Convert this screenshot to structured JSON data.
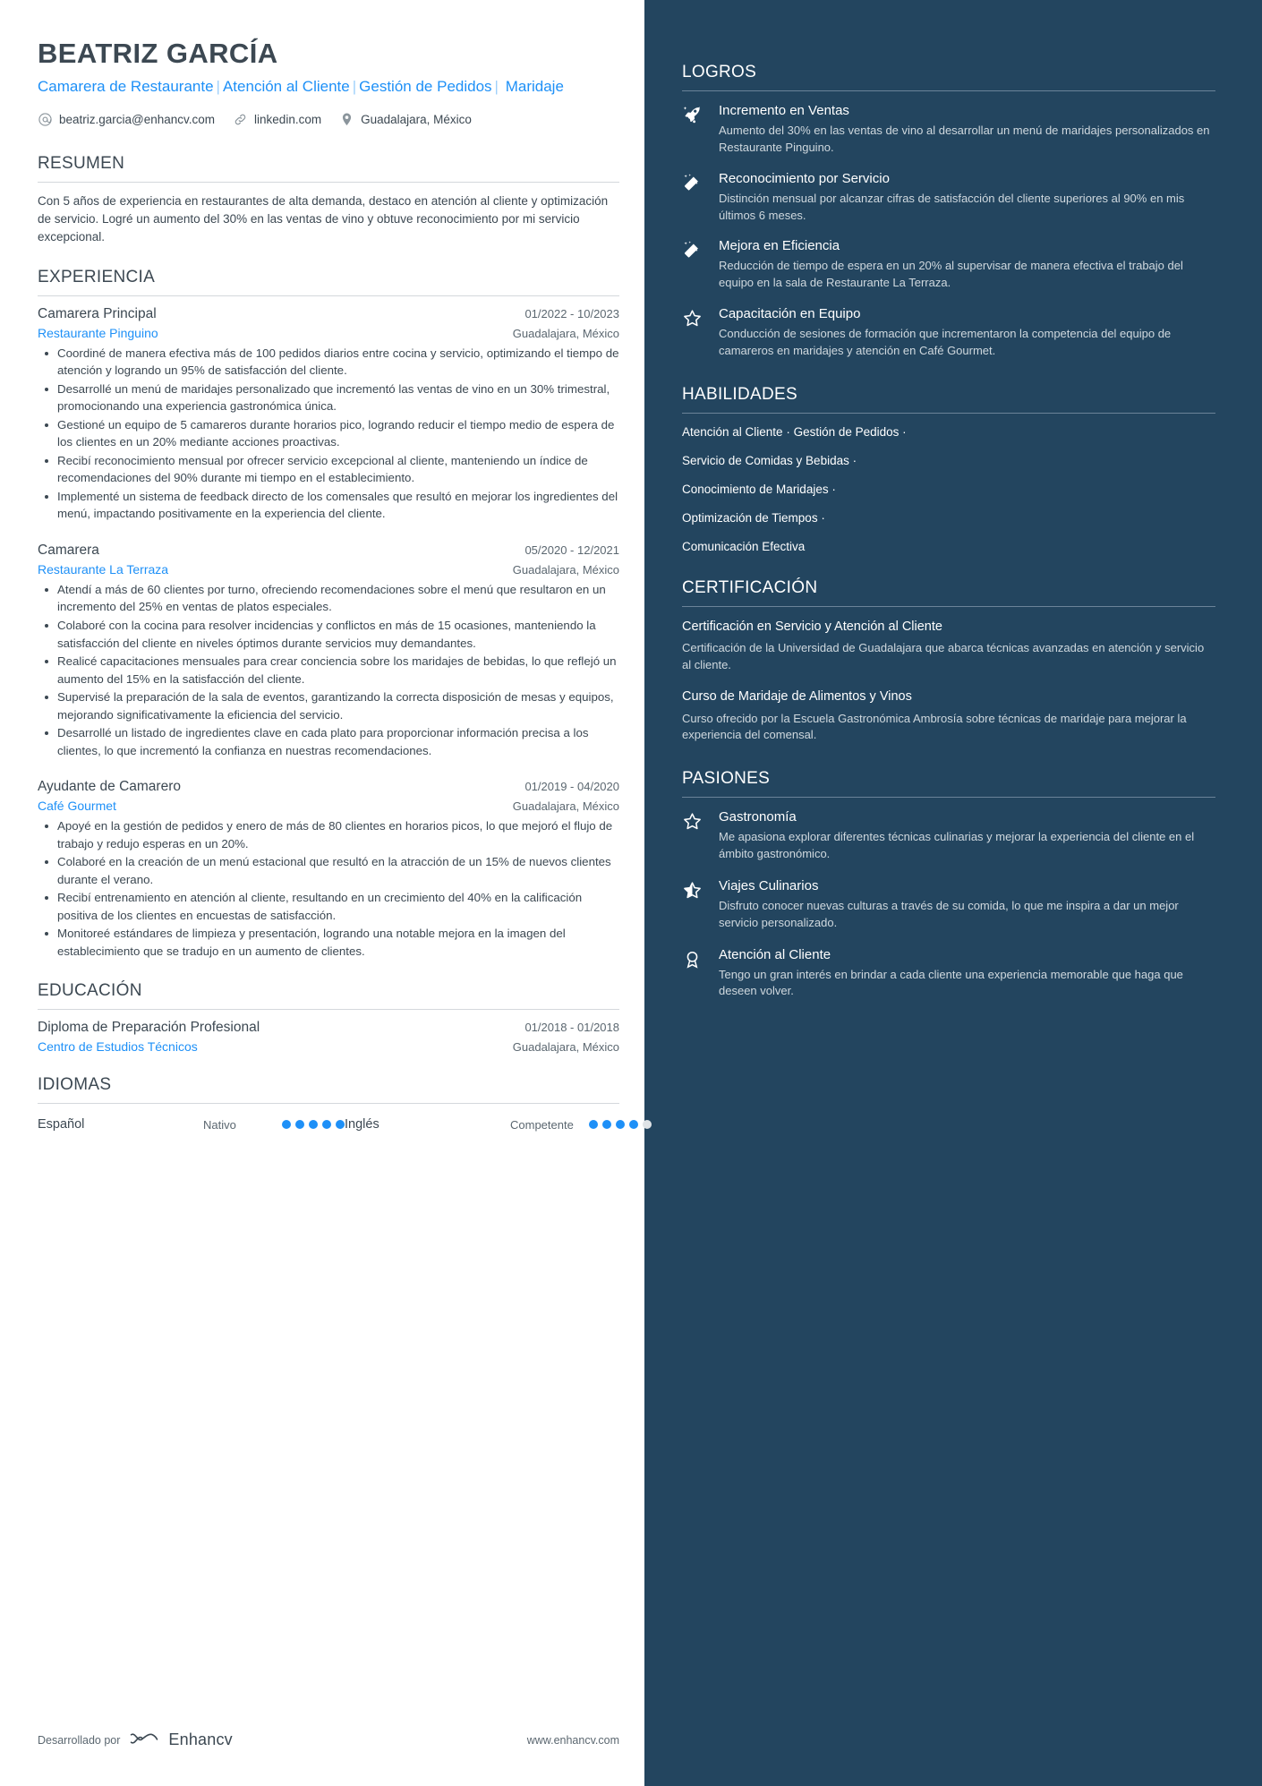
{
  "header": {
    "name": "BEATRIZ GARCÍA",
    "headline_parts": [
      "Camarera de Restaurante",
      "Atención al Cliente",
      "Gestión de Pedidos",
      "Maridaje"
    ],
    "contacts": [
      {
        "icon": "at-icon",
        "text": "beatriz.garcia@enhancv.com"
      },
      {
        "icon": "link-icon",
        "text": "linkedin.com"
      },
      {
        "icon": "location-pin-icon",
        "text": "Guadalajara, México"
      }
    ]
  },
  "colors": {
    "accent": "#1e90f7",
    "sidebar_bg": "#23455f",
    "text": "#3c4852"
  },
  "sections": {
    "resumen": {
      "title": "RESUMEN",
      "text": "Con 5 años de experiencia en restaurantes de alta demanda, destaco en atención al cliente y optimización de servicio. Logré un aumento del 30% en las ventas de vino y obtuve reconocimiento por mi servicio excepcional."
    },
    "experiencia": {
      "title": "EXPERIENCIA",
      "jobs": [
        {
          "title": "Camarera Principal",
          "date": "01/2022 - 10/2023",
          "company": "Restaurante Pinguino",
          "location": "Guadalajara, México",
          "bullets": [
            "Coordiné de manera efectiva más de 100 pedidos diarios entre cocina y servicio, optimizando el tiempo de atención y logrando un 95% de satisfacción del cliente.",
            "Desarrollé un menú de maridajes personalizado que incrementó las ventas de vino en un 30% trimestral, promocionando una experiencia gastronómica única.",
            "Gestioné un equipo de 5 camareros durante horarios pico, logrando reducir el tiempo medio de espera de los clientes en un 20% mediante acciones proactivas.",
            "Recibí reconocimiento mensual por ofrecer servicio excepcional al cliente, manteniendo un índice de recomendaciones del 90% durante mi tiempo en el establecimiento.",
            "Implementé un sistema de feedback directo de los comensales que resultó en mejorar los ingredientes del menú, impactando positivamente en la experiencia del cliente."
          ]
        },
        {
          "title": "Camarera",
          "date": "05/2020 - 12/2021",
          "company": "Restaurante La Terraza",
          "location": "Guadalajara, México",
          "bullets": [
            "Atendí a más de 60 clientes por turno, ofreciendo recomendaciones sobre el menú que resultaron en un incremento del 25% en ventas de platos especiales.",
            "Colaboré con la cocina para resolver incidencias y conflictos en más de 15 ocasiones, manteniendo la satisfacción del cliente en niveles óptimos durante servicios muy demandantes.",
            "Realicé capacitaciones mensuales para crear conciencia sobre los maridajes de bebidas, lo que reflejó un aumento del 15% en la satisfacción del cliente.",
            "Supervisé la preparación de la sala de eventos, garantizando la correcta disposición de mesas y equipos, mejorando significativamente la eficiencia del servicio.",
            "Desarrollé un listado de ingredientes clave en cada plato para proporcionar información precisa a los clientes, lo que incrementó la confianza en nuestras recomendaciones."
          ]
        },
        {
          "title": "Ayudante de Camarero",
          "date": "01/2019 - 04/2020",
          "company": "Café Gourmet",
          "location": "Guadalajara, México",
          "bullets": [
            "Apoyé en la gestión de pedidos y enero de más de 80 clientes en horarios picos, lo que mejoró el flujo de trabajo y redujo esperas en un 20%.",
            "Colaboré en la creación de un menú estacional que resultó en la atracción de un 15% de nuevos clientes durante el verano.",
            "Recibí entrenamiento en atención al cliente, resultando en un crecimiento del 40% en la calificación positiva de los clientes en encuestas de satisfacción.",
            "Monitoreé estándares de limpieza y presentación, logrando una notable mejora en la imagen del establecimiento que se tradujo en un aumento de clientes."
          ]
        }
      ]
    },
    "educacion": {
      "title": "EDUCACIÓN",
      "items": [
        {
          "degree": "Diploma de Preparación Profesional",
          "date": "01/2018 - 01/2018",
          "school": "Centro de Estudios Técnicos",
          "location": "Guadalajara, México"
        }
      ]
    },
    "idiomas": {
      "title": "IDIOMAS",
      "items": [
        {
          "name": "Español",
          "level": "Nativo",
          "dots": 5,
          "total": 5
        },
        {
          "name": "Inglés",
          "level": "Competente",
          "dots": 4,
          "total": 5
        }
      ]
    },
    "logros": {
      "title": "LOGROS",
      "items": [
        {
          "icon": "rocket-sparkle-icon",
          "title": "Incremento en Ventas",
          "desc": "Aumento del 30% en las ventas de vino al desarrollar un menú de maridajes personalizados en Restaurante Pinguino."
        },
        {
          "icon": "magic-wand-icon",
          "title": "Reconocimiento por Servicio",
          "desc": "Distinción mensual por alcanzar cifras de satisfacción del cliente superiores al 90% en mis últimos 6 meses."
        },
        {
          "icon": "magic-wand-icon",
          "title": "Mejora en Eficiencia",
          "desc": "Reducción de tiempo de espera en un 20% al supervisar de manera efectiva el trabajo del equipo en la sala de Restaurante La Terraza."
        },
        {
          "icon": "star-outline-icon",
          "title": "Capacitación en Equipo",
          "desc": "Conducción de sesiones de formación que incrementaron la competencia del equipo de camareros en maridajes y atención en Café Gourmet."
        }
      ]
    },
    "habilidades": {
      "title": "HABILIDADES",
      "lines": [
        "Atención al Cliente · Gestión de Pedidos ·",
        "Servicio de Comidas y Bebidas ·",
        "Conocimiento de Maridajes ·",
        "Optimización de Tiempos ·",
        "Comunicación Efectiva"
      ]
    },
    "certificacion": {
      "title": "CERTIFICACIÓN",
      "items": [
        {
          "title": "Certificación en Servicio y Atención al Cliente",
          "desc": "Certificación de la Universidad de Guadalajara que abarca técnicas avanzadas en atención y servicio al cliente."
        },
        {
          "title": "Curso de Maridaje de Alimentos y Vinos",
          "desc": "Curso ofrecido por la Escuela Gastronómica Ambrosía sobre técnicas de maridaje para mejorar la experiencia del comensal."
        }
      ]
    },
    "pasiones": {
      "title": "PASIONES",
      "items": [
        {
          "icon": "star-outline-icon",
          "title": "Gastronomía",
          "desc": "Me apasiona explorar diferentes técnicas culinarias y mejorar la experiencia del cliente en el ámbito gastronómico."
        },
        {
          "icon": "star-half-icon",
          "title": "Viajes Culinarios",
          "desc": "Disfruto conocer nuevas culturas a través de su comida, lo que me inspira a dar un mejor servicio personalizado."
        },
        {
          "icon": "medal-icon",
          "title": "Atención al Cliente",
          "desc": "Tengo un gran interés en brindar a cada cliente una experiencia memorable que haga que deseen volver."
        }
      ]
    }
  },
  "footer": {
    "made_by": "Desarrollado por",
    "brand": "Enhancv",
    "website": "www.enhancv.com"
  }
}
